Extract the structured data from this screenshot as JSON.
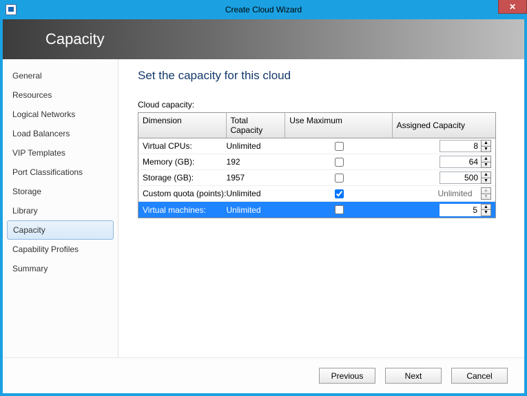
{
  "window": {
    "title": "Create Cloud Wizard",
    "banner": "Capacity"
  },
  "sidebar": {
    "items": [
      {
        "label": "General"
      },
      {
        "label": "Resources"
      },
      {
        "label": "Logical Networks"
      },
      {
        "label": "Load Balancers"
      },
      {
        "label": "VIP Templates"
      },
      {
        "label": "Port Classifications"
      },
      {
        "label": "Storage"
      },
      {
        "label": "Library"
      },
      {
        "label": "Capacity",
        "selected": true
      },
      {
        "label": "Capability Profiles"
      },
      {
        "label": "Summary"
      }
    ]
  },
  "content": {
    "heading": "Set the capacity for this cloud",
    "section_label": "Cloud capacity:",
    "columns": {
      "dimension": "Dimension",
      "total": "Total Capacity",
      "usemax": "Use Maximum",
      "assigned": "Assigned Capacity"
    },
    "rows": [
      {
        "dimension": "Virtual CPUs:",
        "total": "Unlimited",
        "usemax": false,
        "assigned": "8",
        "assigned_unlimited": false,
        "selected": false
      },
      {
        "dimension": "Memory (GB):",
        "total": "192",
        "usemax": false,
        "assigned": "64",
        "assigned_unlimited": false,
        "selected": false
      },
      {
        "dimension": "Storage (GB):",
        "total": "1957",
        "usemax": false,
        "assigned": "500",
        "assigned_unlimited": false,
        "selected": false
      },
      {
        "dimension": "Custom quota (points):",
        "total": "Unlimited",
        "usemax": true,
        "assigned": "Unlimited",
        "assigned_unlimited": true,
        "selected": false
      },
      {
        "dimension": "Virtual machines:",
        "total": "Unlimited",
        "usemax": false,
        "assigned": "5",
        "assigned_unlimited": false,
        "selected": true
      }
    ]
  },
  "footer": {
    "previous": "Previous",
    "next": "Next",
    "cancel": "Cancel"
  }
}
